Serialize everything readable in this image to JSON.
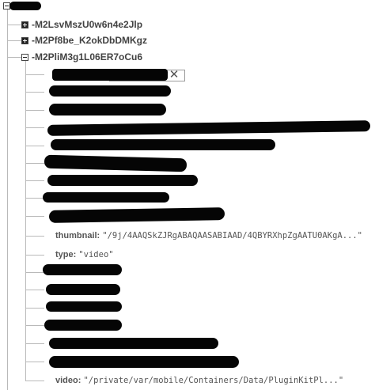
{
  "tree": {
    "children": [
      {
        "key": "-M2LsvMszU0w6n4e2Jlp",
        "state": "collapsed"
      },
      {
        "key": "-M2Pf8be_K2okDbDMKgz",
        "state": "collapsed"
      },
      {
        "key": "-M2PliM3g1L06ER7oCu6",
        "state": "expanded"
      }
    ],
    "fields": {
      "thumbnail": {
        "key": "thumbnail:",
        "value": "\"/9j/4AAQSkZJRgABAQAASABIAAD/4QBYRXhpZgAATU0AKgA...\""
      },
      "type": {
        "key": "type:",
        "value": "\"video\""
      },
      "video": {
        "key": "video:",
        "value": "\"/private/var/mobile/Containers/Data/PluginKitPl...\""
      }
    },
    "close_glyph": "✕"
  }
}
